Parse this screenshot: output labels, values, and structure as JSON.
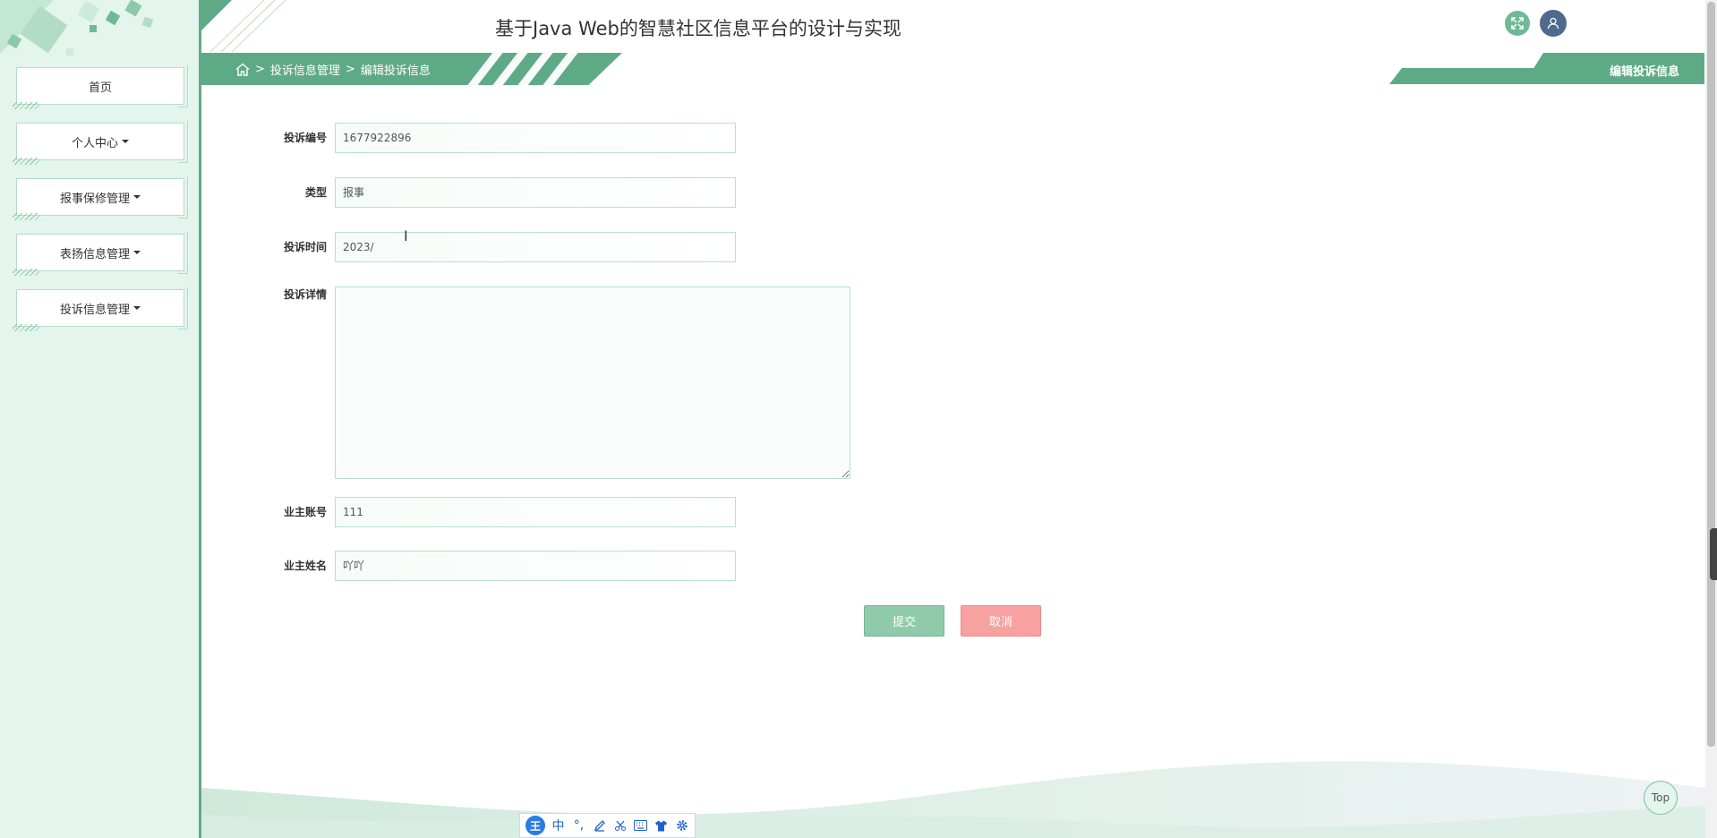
{
  "app": {
    "title": "基于Java Web的智慧社区信息平台的设计与实现"
  },
  "sidebar": {
    "items": [
      {
        "label": "首页",
        "dropdown": false
      },
      {
        "label": "个人中心",
        "dropdown": true
      },
      {
        "label": "报事保修管理",
        "dropdown": true
      },
      {
        "label": "表扬信息管理",
        "dropdown": true
      },
      {
        "label": "投诉信息管理",
        "dropdown": true
      }
    ]
  },
  "breadcrumb": {
    "sep": ">",
    "level1": "投诉信息管理",
    "level2": "编辑投诉信息",
    "current_page": "编辑投诉信息"
  },
  "form": {
    "complaint_no": {
      "label": "投诉编号",
      "value": "1677922896"
    },
    "type": {
      "label": "类型",
      "value": "报事"
    },
    "complaint_time": {
      "label": "投诉时间",
      "value": "2023/"
    },
    "detail": {
      "label": "投诉详情",
      "value": ""
    },
    "owner_account": {
      "label": "业主账号",
      "value": "111"
    },
    "owner_name": {
      "label": "业主姓名",
      "value": "吖吖"
    }
  },
  "buttons": {
    "submit": "提交",
    "cancel": "取消",
    "top": "Top"
  },
  "ime_toolbar": {
    "logo": "王",
    "mode": "中",
    "punct": "°,",
    "handwrite_icon": "pen-icon",
    "scissors_icon": "scissors-icon",
    "keyboard_icon": "keyboard-icon",
    "skin_icon": "shirt-icon",
    "settings_icon": "gear-icon"
  },
  "colors": {
    "accent": "#5faa86",
    "sidebar_bg": "#e3f5ec",
    "submit": "#8fcaaa",
    "cancel": "#f7a1a1",
    "user_btn": "#4e6a8c"
  }
}
